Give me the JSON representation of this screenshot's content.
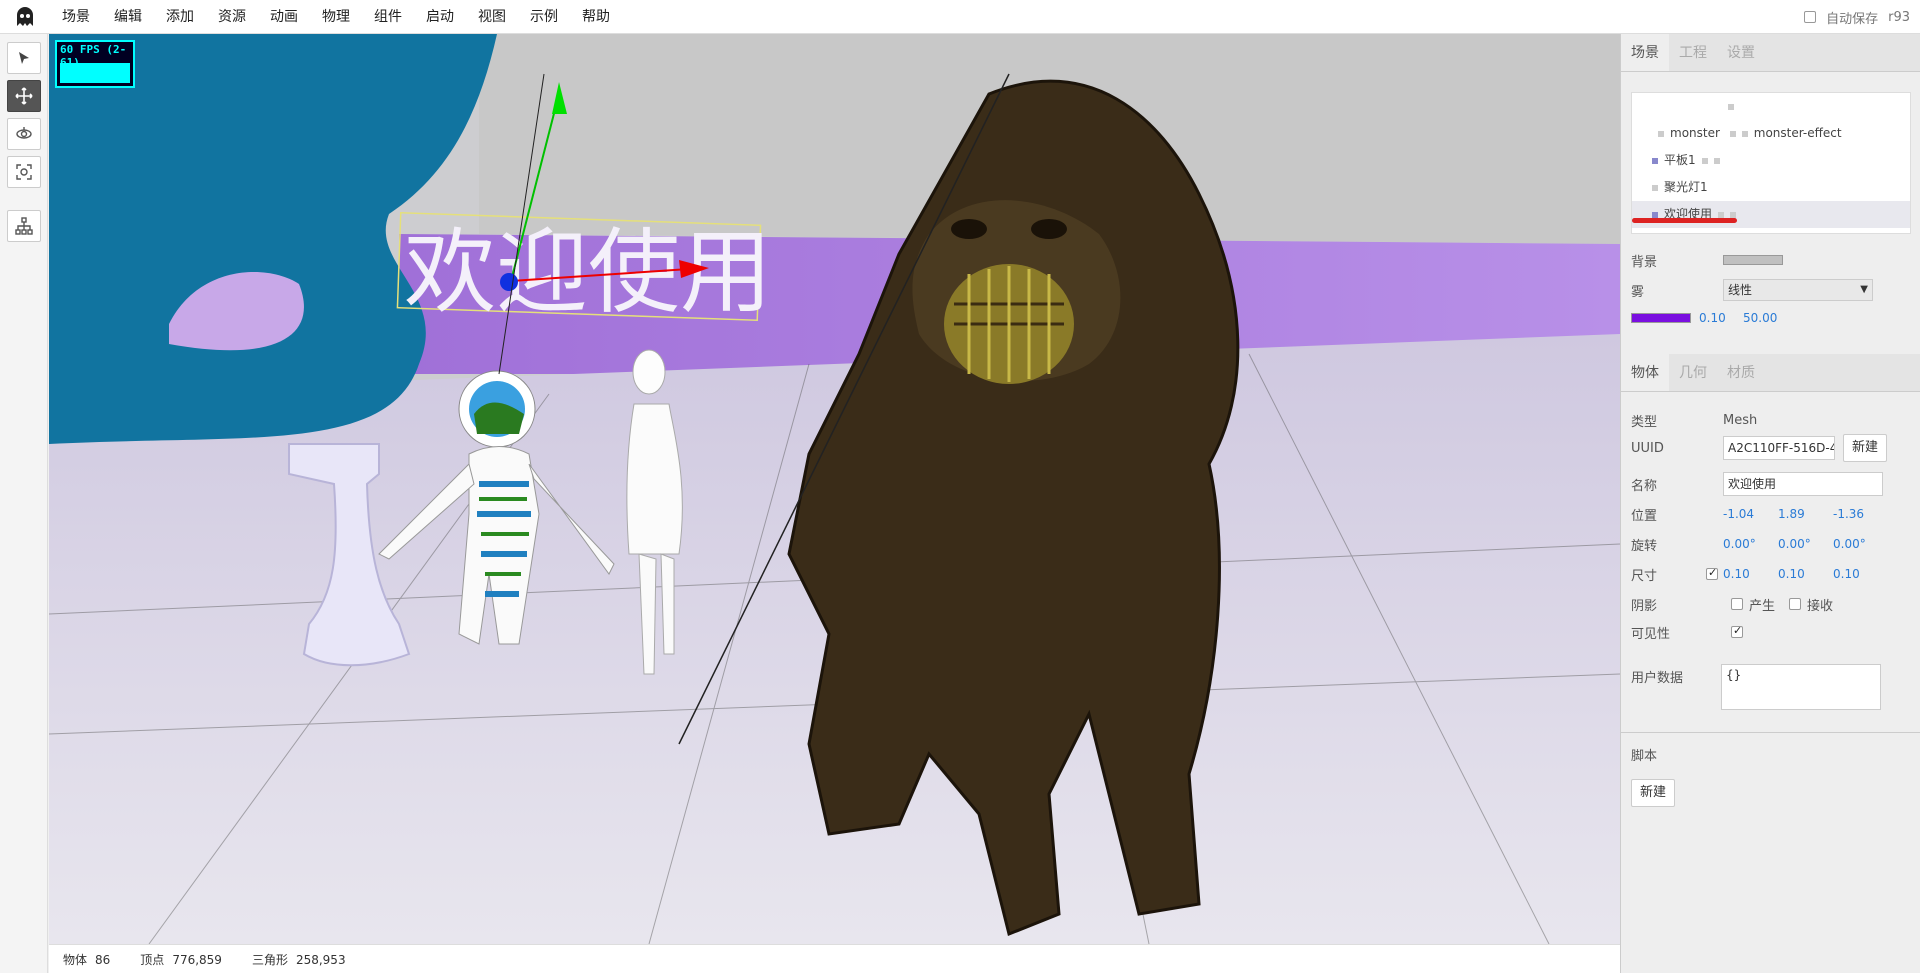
{
  "menu": {
    "items": [
      "场景",
      "编辑",
      "添加",
      "资源",
      "动画",
      "物理",
      "组件",
      "启动",
      "视图",
      "示例",
      "帮助"
    ],
    "autosave_label": "自动保存",
    "version": "r93"
  },
  "toolbar": {
    "tools": [
      "select-tool",
      "translate-tool",
      "rotate-tool",
      "scale-tool",
      "hierarchy-tool"
    ],
    "active": "translate-tool"
  },
  "viewport": {
    "fps_text": "60 FPS (2-61)",
    "scene_text": "欢迎使用"
  },
  "statusbar": {
    "objects_label": "物体",
    "objects_value": "86",
    "vertices_label": "顶点",
    "vertices_value": "776,859",
    "triangles_label": "三角形",
    "triangles_value": "258,953"
  },
  "sidebar": {
    "tabs": [
      "场景",
      "工程",
      "设置"
    ],
    "outliner": {
      "row1": "monster",
      "row1b": "monster-effect",
      "row2": "平板1",
      "row3": "聚光灯1",
      "row4": "欢迎使用"
    },
    "background_label": "背景",
    "fog_label": "雾",
    "fog_type": "线性",
    "fog_near": "0.10",
    "fog_far": "50.00",
    "fog_color": "#7a0fe0",
    "background_color": "#c0c0c0",
    "object_tabs": [
      "物体",
      "几何",
      "材质"
    ],
    "type_label": "类型",
    "type_value": "Mesh",
    "uuid_label": "UUID",
    "uuid_value": "A2C110FF-516D-4",
    "new_label": "新建",
    "name_label": "名称",
    "name_value": "欢迎使用",
    "position_label": "位置",
    "position": [
      "-1.04",
      "1.89",
      "-1.36"
    ],
    "rotation_label": "旋转",
    "rotation": [
      "0.00°",
      "0.00°",
      "0.00°"
    ],
    "scale_label": "尺寸",
    "scale": [
      "0.10",
      "0.10",
      "0.10"
    ],
    "shadow_label": "阴影",
    "shadow_cast": "产生",
    "shadow_receive": "接收",
    "visible_label": "可见性",
    "userdata_label": "用户数据",
    "userdata_value": "{}",
    "script_label": "脚本",
    "script_new": "新建"
  }
}
